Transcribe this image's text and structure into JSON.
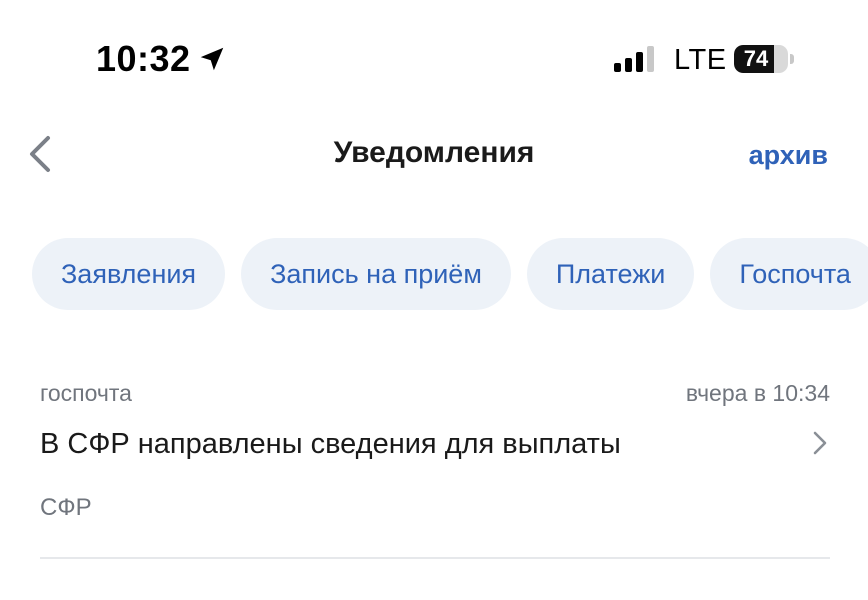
{
  "status_bar": {
    "time": "10:32",
    "network": "LTE",
    "battery": "74",
    "battery_level": 0.74,
    "location_icon": "location-arrow-icon",
    "signal_icon": "cellular-signal-icon"
  },
  "header": {
    "title": "Уведомления",
    "archive_label": "архив",
    "back_icon": "chevron-left-icon"
  },
  "filters": {
    "chips": [
      "Заявления",
      "Запись на приём",
      "Платежи",
      "Госпочта"
    ]
  },
  "notifications": [
    {
      "source": "госпочта",
      "time": "вчера в 10:34",
      "title": "В СФР направлены сведения для выплаты",
      "organization": "СФР"
    }
  ],
  "colors": {
    "accent": "#2f62b8",
    "chip_background": "#edf2f8",
    "secondary_text": "#70757d",
    "divider": "#e6e8eb"
  }
}
